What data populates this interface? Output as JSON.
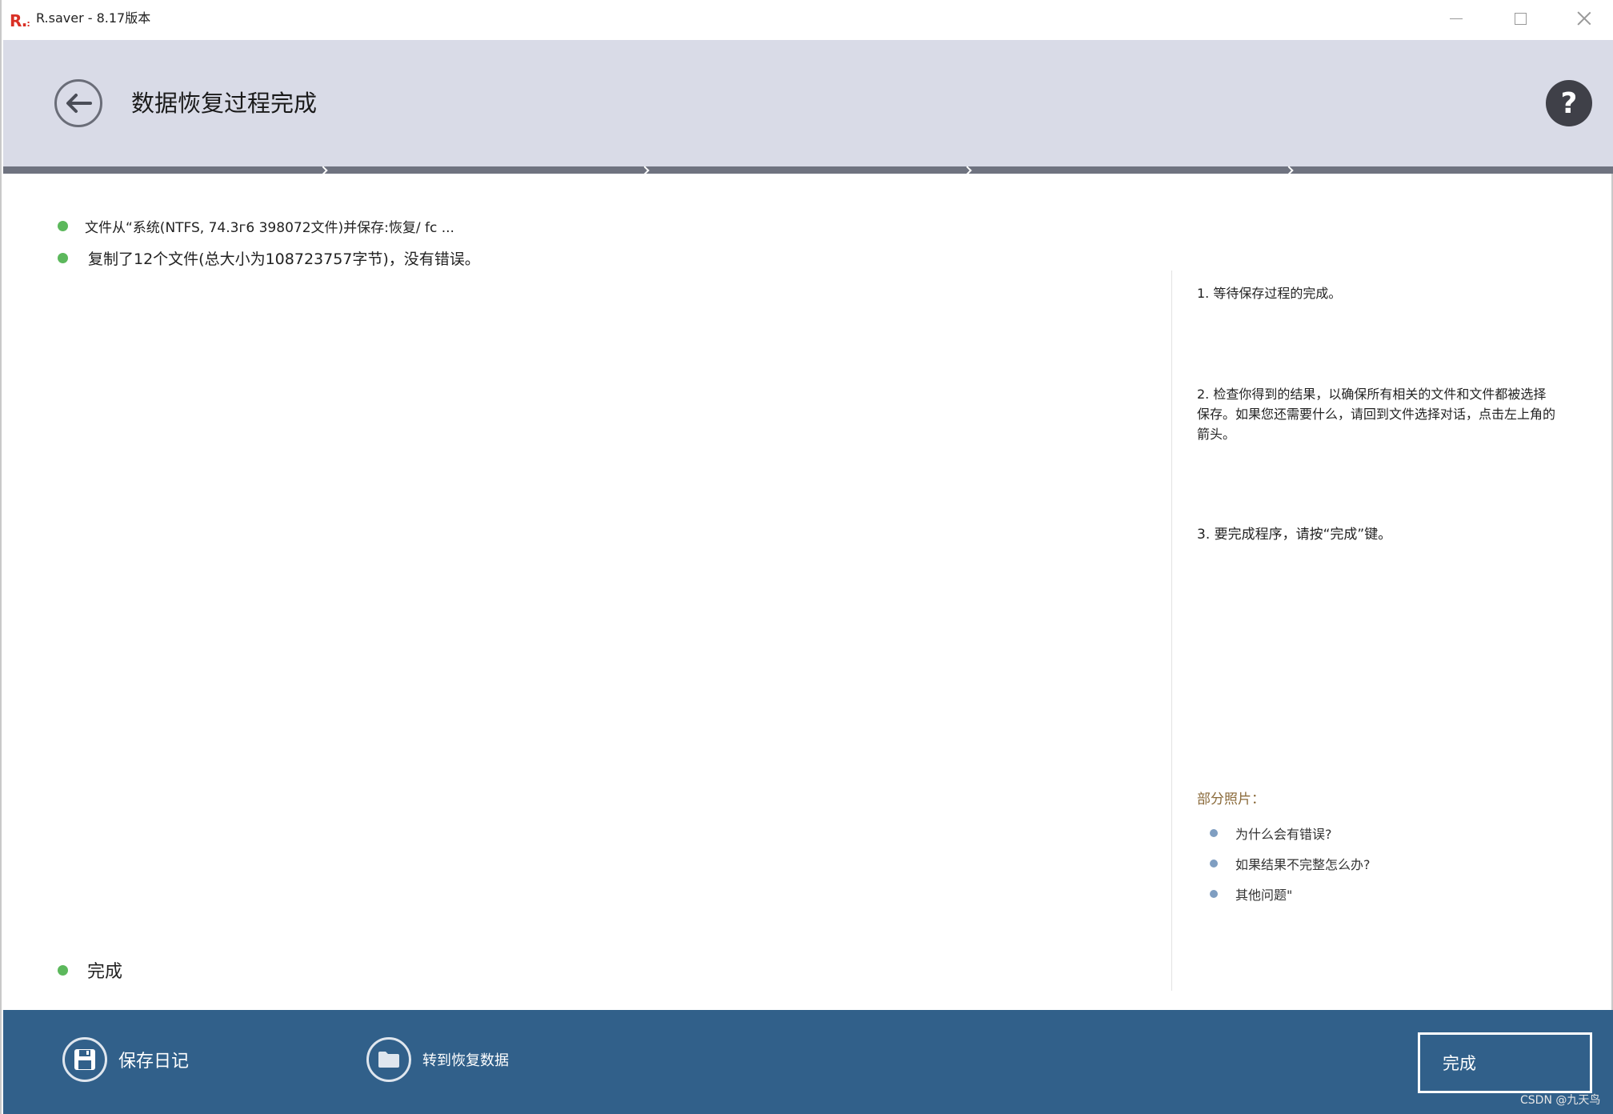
{
  "window": {
    "logo_text": "R.",
    "title": "R.saver - 8.17版本"
  },
  "header": {
    "title": "数据恢复过程完成",
    "help_label": "?"
  },
  "status": {
    "lines": [
      "文件从“系统(NTFS, 74.3г6 398072文件)并保存:恢复/ fc ...",
      "复制了12个文件(总大小为108723757字节)，没有错误。"
    ],
    "done": "完成"
  },
  "help_panel": {
    "step1": "1. 等待保存过程的完成。",
    "step2": "2. 检查你得到的结果，以确保所有相关的文件和文件都被选择保存。如果您还需要什么，请回到文件选择对话，点击左上角的箭头。",
    "step3": "3. 要完成程序，请按“完成”键。",
    "faq_title": "部分照片：",
    "faq": [
      "为什么会有错误?",
      "如果结果不完整怎么办?",
      "其他问题\""
    ]
  },
  "footer": {
    "save_log": "保存日记",
    "goto_data": "转到恢复数据",
    "finish": "完成"
  },
  "watermark": "CSDN @九天鸟",
  "colors": {
    "header_bg": "#d9dbe7",
    "footer_bg": "#31608a",
    "status_dot": "#5cb85c",
    "faq_dot": "#7f9ec1",
    "logo": "#d93025"
  },
  "icons": {
    "back": "arrow-left-icon",
    "help": "question-icon",
    "save": "floppy-disk-icon",
    "folder": "folder-icon"
  }
}
